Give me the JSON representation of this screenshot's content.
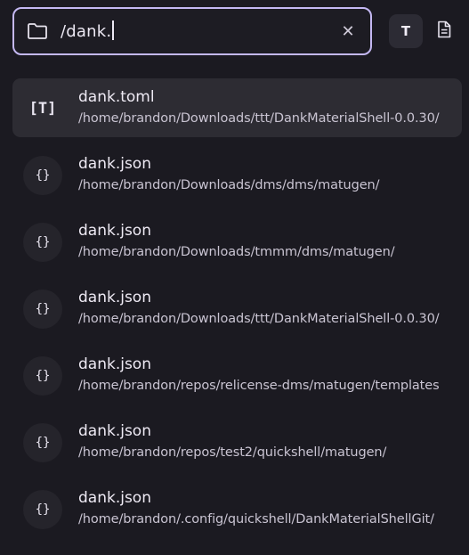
{
  "search": {
    "query": "/dank.",
    "clear_glyph": "✕"
  },
  "modes": {
    "text_mode_label": "T",
    "file_mode_icon": "file-document-icon"
  },
  "results": [
    {
      "name": "dank.toml",
      "path": "/home/brandon/Downloads/ttt/DankMaterialShell-0.0.30/",
      "icon": "[T]",
      "icon_name": "toml-file-icon",
      "selected": true
    },
    {
      "name": "dank.json",
      "path": "/home/brandon/Downloads/dms/dms/matugen/",
      "icon": "{}",
      "icon_name": "json-file-icon",
      "selected": false
    },
    {
      "name": "dank.json",
      "path": "/home/brandon/Downloads/tmmm/dms/matugen/",
      "icon": "{}",
      "icon_name": "json-file-icon",
      "selected": false
    },
    {
      "name": "dank.json",
      "path": "/home/brandon/Downloads/ttt/DankMaterialShell-0.0.30/",
      "icon": "{}",
      "icon_name": "json-file-icon",
      "selected": false
    },
    {
      "name": "dank.json",
      "path": "/home/brandon/repos/relicense-dms/matugen/templates",
      "icon": "{}",
      "icon_name": "json-file-icon",
      "selected": false
    },
    {
      "name": "dank.json",
      "path": "/home/brandon/repos/test2/quickshell/matugen/",
      "icon": "{}",
      "icon_name": "json-file-icon",
      "selected": false
    },
    {
      "name": "dank.json",
      "path": "/home/brandon/.config/quickshell/DankMaterialShellGit/",
      "icon": "{}",
      "icon_name": "json-file-icon",
      "selected": false
    }
  ],
  "colors": {
    "background": "#1b1a21",
    "accent_border": "#c4b8f2",
    "selected_row": "#2d2c33"
  }
}
